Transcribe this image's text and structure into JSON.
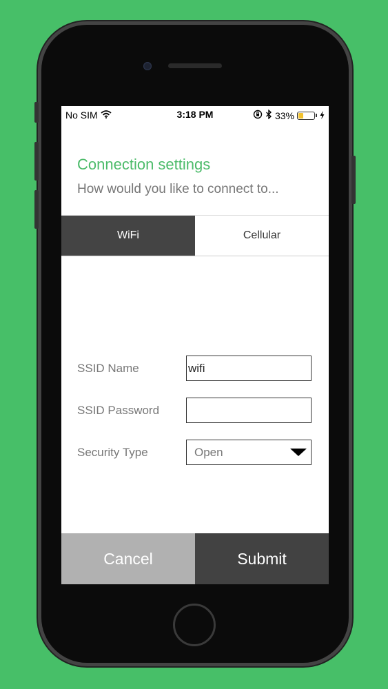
{
  "status_bar": {
    "carrier": "No SIM",
    "time": "3:18 PM",
    "battery_percent": "33%",
    "battery_level": 0.33,
    "battery_color": "#f2c230"
  },
  "header": {
    "title": "Connection settings",
    "subtitle": "How would you like to connect to..."
  },
  "tabs": [
    {
      "label": "WiFi",
      "active": true
    },
    {
      "label": "Cellular",
      "active": false
    }
  ],
  "form": {
    "ssid_name_label": "SSID Name",
    "ssid_name_value": "wifi",
    "ssid_password_label": "SSID Password",
    "ssid_password_value": "",
    "security_type_label": "Security Type",
    "security_type_value": "Open"
  },
  "actions": {
    "cancel_label": "Cancel",
    "submit_label": "Submit"
  },
  "colors": {
    "background": "#47bf68",
    "accent": "#4cbb6a",
    "tab_active": "#444444",
    "cancel": "#b1b1b1",
    "submit": "#424242"
  }
}
